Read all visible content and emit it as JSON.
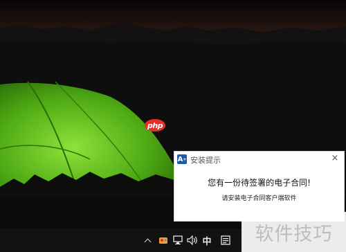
{
  "desktop": {
    "wallpaper": "night-tent-landscape",
    "logo_text": "php"
  },
  "notification": {
    "app_icon": "A",
    "title": "安装提示",
    "headline": "您有一份待签署的电子合同!",
    "body": "请安装电子合同客户端软件",
    "close_icon": "×"
  },
  "taskbar": {
    "tray": {
      "show_hidden_icon": "chevron-up-icon",
      "app_icon": "tray-app-icon",
      "network_icon": "network-icon",
      "volume_icon": "volume-icon",
      "ime_label": "中",
      "action_center_icon": "action-center-icon"
    }
  },
  "watermark": {
    "text": "软件技巧"
  },
  "colors": {
    "tent": "#5bc21c",
    "toast_bg": "#ffffff",
    "taskbar_bg": "#121212",
    "app_icon_bg": "#1e5aa8",
    "php_logo": "#e53027"
  }
}
